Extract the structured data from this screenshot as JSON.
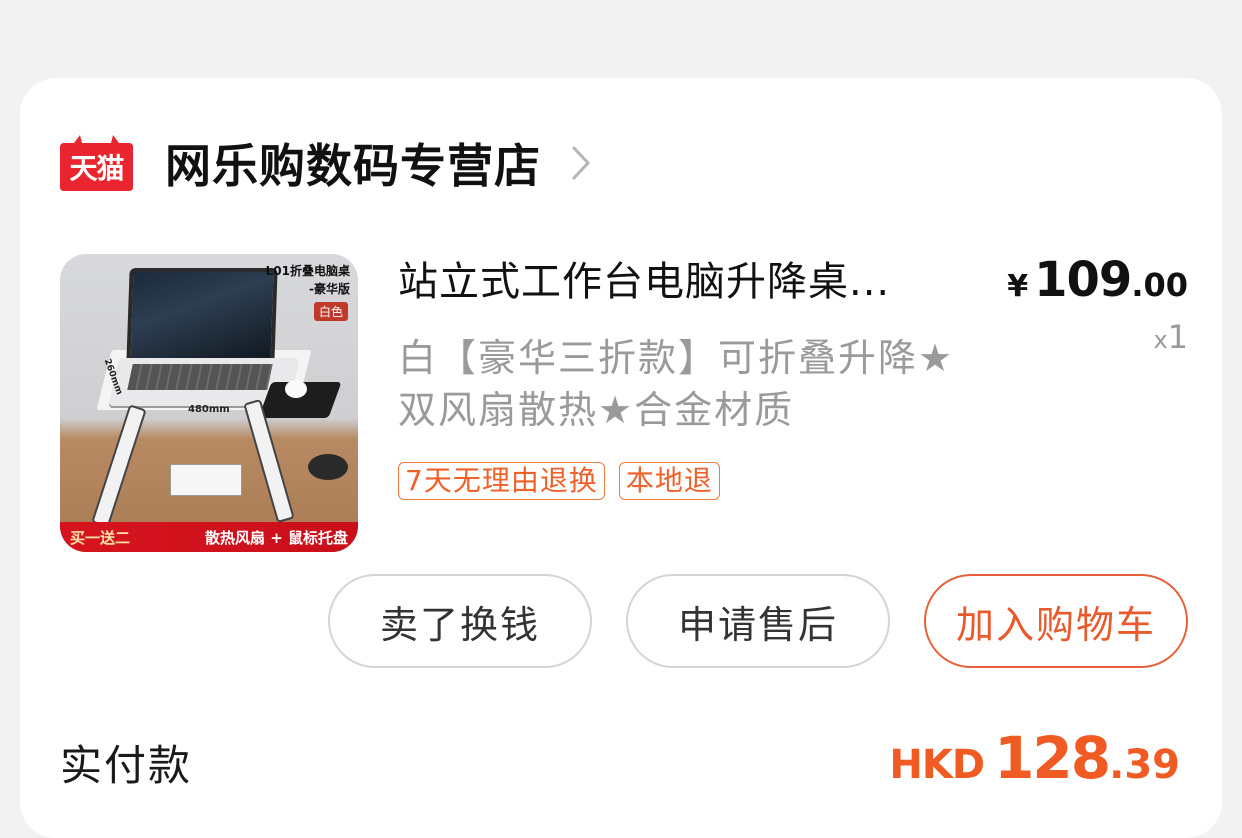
{
  "shop": {
    "badge_text": "天猫",
    "name": "网乐购数码专营店",
    "badge_color": "#e9262f",
    "chevron_icon": "chevron-right-icon"
  },
  "product": {
    "image": {
      "title_line1": "L01折叠电脑桌",
      "title_line2": "-豪华版",
      "color_tag": "白色",
      "dimension_width": "480mm",
      "dimension_depth": "260mm",
      "banner_left": "买一送二",
      "banner_right": "散热风扇 + 鼠标托盘"
    },
    "title": "站立式工作台电脑升降桌...",
    "sku": "白【豪华三折款】可折叠升降★双风扇散热★合金材质",
    "tags": [
      "7天无理由退换",
      "本地退"
    ],
    "price": {
      "symbol": "¥",
      "integer": "109",
      "decimal": ".00"
    },
    "quantity_prefix": "x",
    "quantity": "1"
  },
  "actions": {
    "sell": "卖了换钱",
    "aftersale": "申请售后",
    "add_to_cart": "加入购物车"
  },
  "payment": {
    "label": "实付款",
    "currency": "HKD",
    "integer": "128",
    "decimal": ".39",
    "accent_color": "#ef5b22"
  }
}
